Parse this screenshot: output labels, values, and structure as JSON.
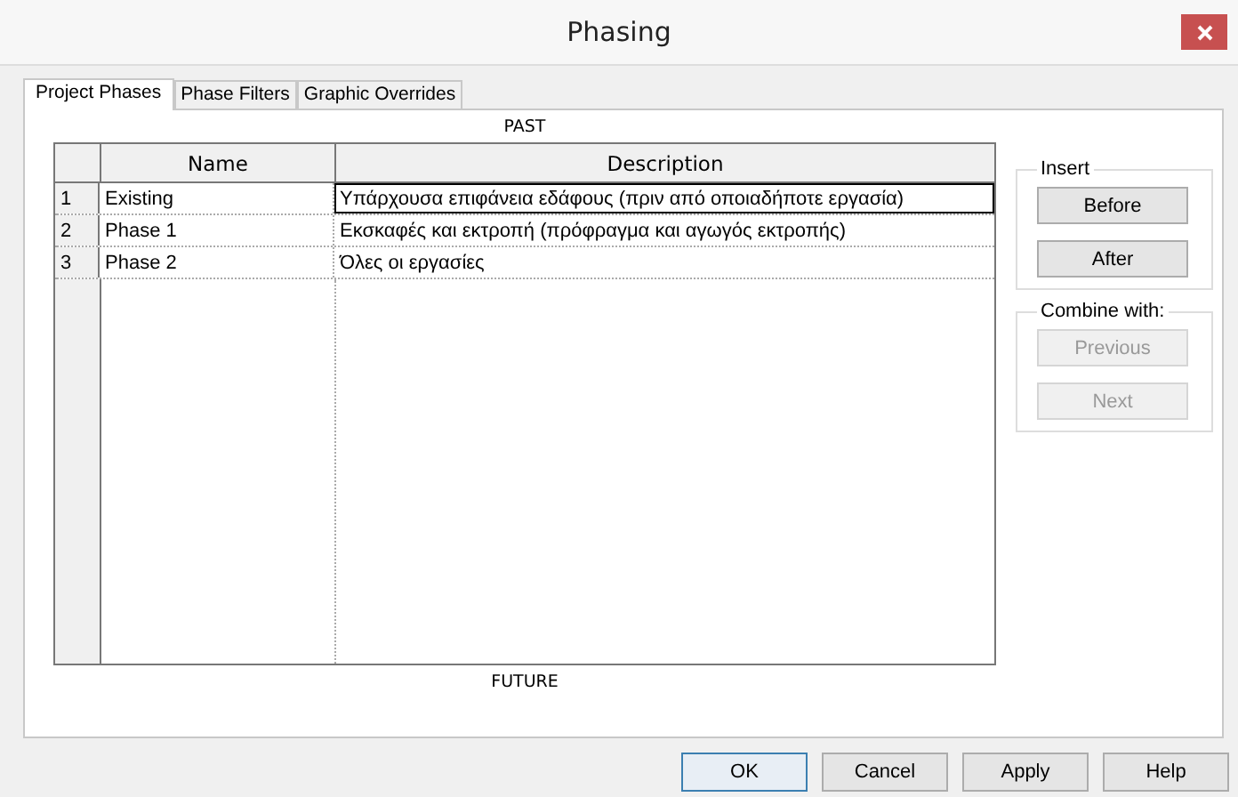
{
  "window": {
    "title": "Phasing"
  },
  "tabs": [
    {
      "label": "Project Phases",
      "selected": true
    },
    {
      "label": "Phase Filters",
      "selected": false
    },
    {
      "label": "Graphic Overrides",
      "selected": false
    }
  ],
  "past_label": "PAST",
  "table": {
    "columns": [
      "Name",
      "Description"
    ],
    "rows": [
      {
        "number": "1",
        "name": "Existing",
        "description": "Υπάρχουσα επιφάνεια εδάφους (πριν από οποιαδήποτε εργασία)",
        "current": true
      },
      {
        "number": "2",
        "name": "Phase 1",
        "description": "Εκσκαφές και εκτροπή (πρόφραγμα και αγωγός εκτροπής)",
        "current": false
      },
      {
        "number": "3",
        "name": "Phase 2",
        "description": "Όλες οι εργασίες",
        "current": false
      }
    ]
  },
  "future_label": "FUTURE",
  "insert_group": {
    "title": "Insert",
    "buttons": [
      {
        "label": "Before",
        "disabled": false
      },
      {
        "label": "After",
        "disabled": false
      }
    ]
  },
  "combine_group": {
    "title": "Combine with:",
    "buttons": [
      {
        "label": "Previous",
        "disabled": true
      },
      {
        "label": "Next",
        "disabled": true
      }
    ]
  },
  "buttons": [
    {
      "label": "OK",
      "default": true
    },
    {
      "label": "Cancel",
      "default": false
    },
    {
      "label": "Apply",
      "default": false
    },
    {
      "label": "Help",
      "default": false
    }
  ]
}
